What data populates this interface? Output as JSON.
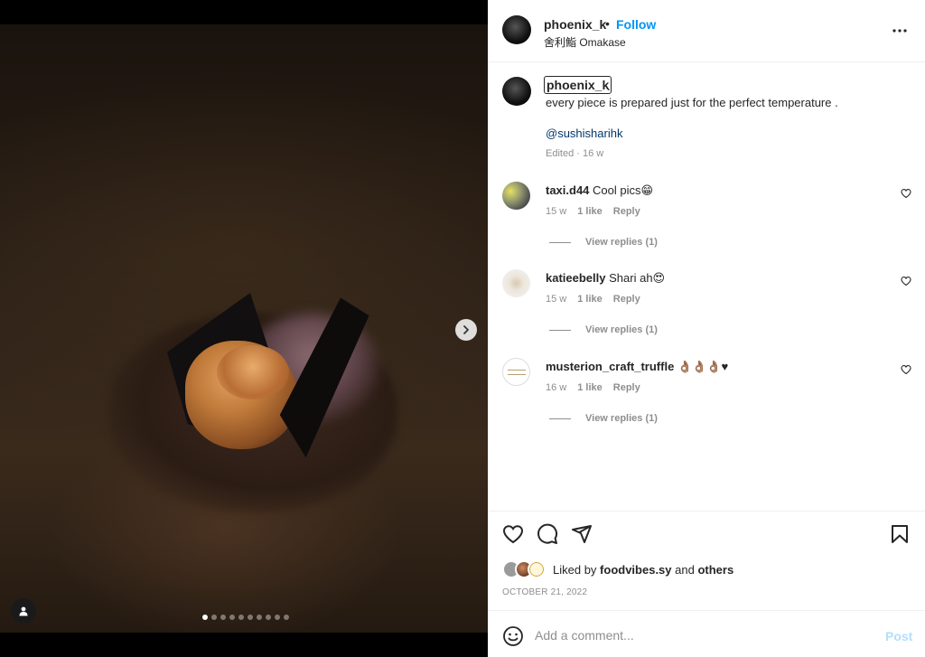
{
  "post": {
    "username": "phoenix_k",
    "separator": "•",
    "follow_label": "Follow",
    "location": "舍利鮨 Omakase"
  },
  "caption": {
    "username": "phoenix_k",
    "dot": ".",
    "text": "every piece is prepared just for the perfect temperature .",
    "mention": "@sushisharihk",
    "meta": "Edited · 16 w"
  },
  "comments": [
    {
      "user": "taxi.d44",
      "text": "Cool pics😁",
      "time": "15 w",
      "likes": "1 like",
      "reply": "Reply",
      "view_replies": "View replies (1)"
    },
    {
      "user": "katieebelly",
      "text": "Shari ah😍",
      "time": "15 w",
      "likes": "1 like",
      "reply": "Reply",
      "view_replies": "View replies (1)"
    },
    {
      "user": "musterion_craft_truffle",
      "text": "👌🏽👌🏽👌🏽♥",
      "time": "16 w",
      "likes": "1 like",
      "reply": "Reply",
      "view_replies": "View replies (1)"
    }
  ],
  "likes": {
    "prefix": "Liked by",
    "user": "foodvibes.sy",
    "middle": "and",
    "others": "others"
  },
  "date": "OCTOBER 21, 2022",
  "add_comment": {
    "placeholder": "Add a comment...",
    "post_label": "Post"
  },
  "carousel": {
    "slides": 10,
    "active_index": 0
  },
  "colors": {
    "link": "#0095f6",
    "post_disabled": "#b2dffc",
    "mention": "#00376b",
    "muted": "#8e8e8e"
  },
  "icons": [
    "chevron-right-icon",
    "user-tag-icon",
    "more-icon",
    "heart-icon",
    "comment-icon",
    "share-icon",
    "bookmark-icon",
    "emoji-icon"
  ]
}
